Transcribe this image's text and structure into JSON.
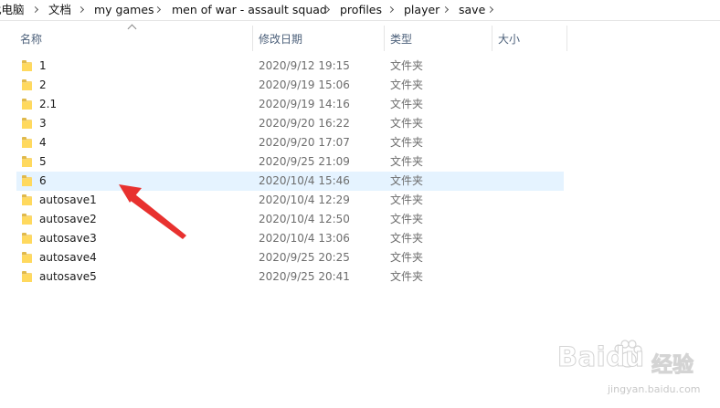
{
  "breadcrumb": [
    "此电脑",
    "文档",
    "my games",
    "men of war - assault squad",
    "profiles",
    "player",
    "save"
  ],
  "columns": {
    "name": "名称",
    "date": "修改日期",
    "type": "类型",
    "size": "大小"
  },
  "files": [
    {
      "name": "1",
      "date": "2020/9/12 19:15",
      "type": "文件夹"
    },
    {
      "name": "2",
      "date": "2020/9/19 15:06",
      "type": "文件夹"
    },
    {
      "name": "2.1",
      "date": "2020/9/19 14:16",
      "type": "文件夹"
    },
    {
      "name": "3",
      "date": "2020/9/20 16:22",
      "type": "文件夹"
    },
    {
      "name": "4",
      "date": "2020/9/20 17:07",
      "type": "文件夹"
    },
    {
      "name": "5",
      "date": "2020/9/25 21:09",
      "type": "文件夹"
    },
    {
      "name": "6",
      "date": "2020/10/4 15:46",
      "type": "文件夹",
      "selected": true
    },
    {
      "name": "autosave1",
      "date": "2020/10/4 12:29",
      "type": "文件夹"
    },
    {
      "name": "autosave2",
      "date": "2020/10/4 12:50",
      "type": "文件夹"
    },
    {
      "name": "autosave3",
      "date": "2020/10/4 13:06",
      "type": "文件夹"
    },
    {
      "name": "autosave4",
      "date": "2020/9/25 20:25",
      "type": "文件夹"
    },
    {
      "name": "autosave5",
      "date": "2020/9/25 20:41",
      "type": "文件夹"
    }
  ],
  "icons": {
    "folder": "folder-icon",
    "chevron": "chevron-right-icon",
    "sort": "sort-ascending-icon"
  },
  "colors": {
    "selection": "#e5f3ff",
    "folder": "#ffd95e",
    "annotation_arrow": "#e8312f"
  },
  "watermark": {
    "brand": "Baidu",
    "product": "经验",
    "url": "jingyan.baidu.com"
  }
}
